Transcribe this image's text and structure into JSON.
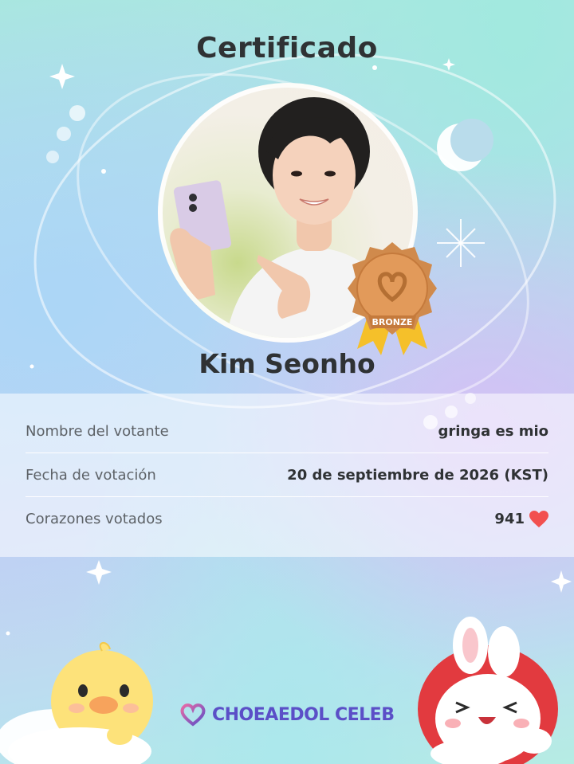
{
  "certificate": {
    "title": "Certificado",
    "celeb_name": "Kim Seonho",
    "badge_label": "BRONZE",
    "badge_tier": "bronze"
  },
  "details": [
    {
      "label": "Nombre del votante",
      "value": "gringa es mio"
    },
    {
      "label": "Fecha de votación",
      "value": "20 de septiembre de 2026 (KST)"
    },
    {
      "label": "Corazones votados",
      "value": "941"
    }
  ],
  "brand": {
    "name": "CHOEAEDOL CELEB"
  },
  "icons": {
    "heart": "heart-icon",
    "logo": "choeaedol-logo-icon",
    "badge": "bronze-medal-icon"
  },
  "colors": {
    "heart": "#f2504f",
    "bronze": "#d08a4c",
    "ribbon": "#f5c02a",
    "brand": "#5b4fc7"
  }
}
